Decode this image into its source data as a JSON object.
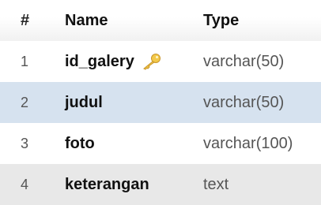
{
  "table": {
    "headers": {
      "num": "#",
      "name": "Name",
      "type": "Type"
    },
    "rows": [
      {
        "num": "1",
        "name": "id_galery",
        "type": "varchar(50)",
        "icon": "key-icon"
      },
      {
        "num": "2",
        "name": "judul",
        "type": "varchar(50)"
      },
      {
        "num": "3",
        "name": "foto",
        "type": "varchar(100)"
      },
      {
        "num": "4",
        "name": "keterangan",
        "type": "text"
      }
    ]
  },
  "colors": {
    "highlight_row": "#d6e2ef",
    "alt_row": "#e8e8e8",
    "key_icon": "#f0c040"
  }
}
